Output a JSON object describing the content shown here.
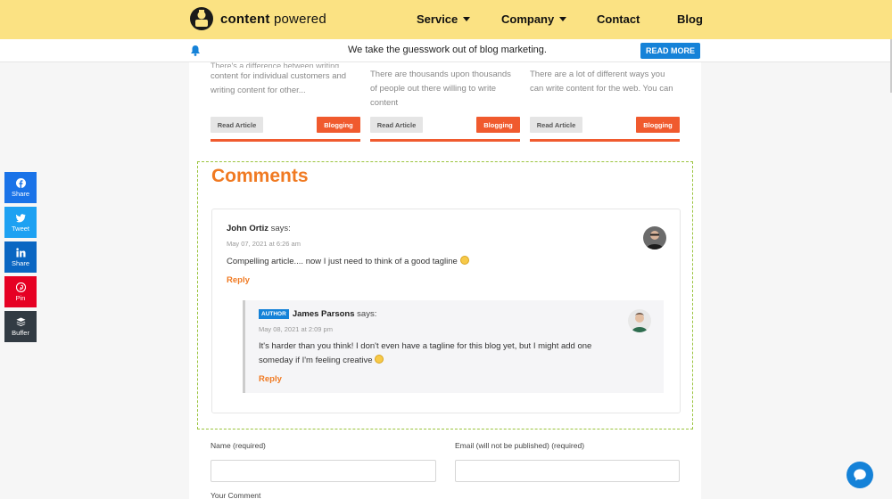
{
  "brand": {
    "name_part1": "content",
    "name_part2": "powered"
  },
  "nav": {
    "service": "Service",
    "company": "Company",
    "contact": "Contact",
    "blog": "Blog"
  },
  "announcement": {
    "text": "We take the guesswork out of blog marketing.",
    "button": "READ MORE"
  },
  "articles": [
    {
      "excerpt_fade": "There's a difference between writing",
      "excerpt": "content for individual customers and writing content for other...",
      "read_label": "Read Article",
      "tag": "Blogging"
    },
    {
      "excerpt": "There are thousands upon thousands of people out there willing to write content",
      "read_label": "Read Article",
      "tag": "Blogging"
    },
    {
      "excerpt": "There are a lot of different ways you can write content for the web. You can",
      "read_label": "Read Article",
      "tag": "Blogging"
    }
  ],
  "comments": {
    "title": "Comments",
    "items": [
      {
        "author": "John Ortiz",
        "says": "says:",
        "date": "May 07, 2021 at 6:26 am",
        "text": "Compelling article.... now I just need to think of a good tagline",
        "reply_label": "Reply",
        "replies": [
          {
            "badge": "AUTHOR",
            "author": "James Parsons",
            "says": "says:",
            "date": "May 08, 2021 at 2:09 pm",
            "text": "It's harder than you think! I don't even have a tagline for this blog yet, but I might add one someday if I'm feeling creative",
            "reply_label": "Reply"
          }
        ]
      }
    ]
  },
  "form": {
    "name_label": "Name (required)",
    "email_label": "Email (will not be published) (required)",
    "comment_label": "Your Comment"
  },
  "share": [
    {
      "label": "Share",
      "icon": "facebook-icon",
      "color": "#1a73e8"
    },
    {
      "label": "Tweet",
      "icon": "twitter-icon",
      "color": "#1da1f2"
    },
    {
      "label": "Share",
      "icon": "linkedin-icon",
      "color": "#0a66c2"
    },
    {
      "label": "Pin",
      "icon": "pinterest-icon",
      "color": "#e60023"
    },
    {
      "label": "Buffer",
      "icon": "buffer-icon",
      "color": "#323b43"
    }
  ],
  "colors": {
    "header": "#fbe283",
    "accent": "#f07a22",
    "tag": "#f05a2e",
    "primary": "#1582d8",
    "dashed_border": "#9bc43e"
  }
}
